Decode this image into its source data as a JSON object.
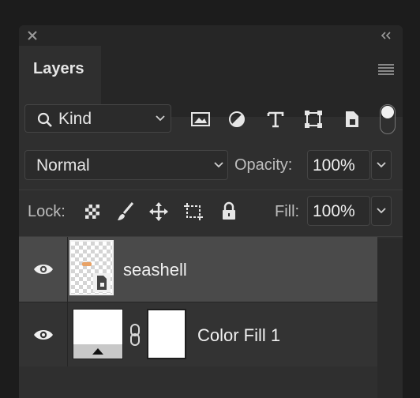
{
  "panel": {
    "tab_label": "Layers"
  },
  "filter": {
    "kind_label": "Kind",
    "filter_icons": [
      "image-filter-icon",
      "adjustment-filter-icon",
      "type-filter-icon",
      "shape-filter-icon",
      "smart-object-filter-icon"
    ],
    "toggle": "filter-toggle"
  },
  "blend": {
    "mode": "Normal",
    "opacity_label": "Opacity:",
    "opacity_value": "100%"
  },
  "lock": {
    "label": "Lock:",
    "icons": [
      "lock-transparent-pixels-icon",
      "lock-image-pixels-icon",
      "lock-position-icon",
      "lock-artboard-icon",
      "lock-all-icon"
    ],
    "fill_label": "Fill:",
    "fill_value": "100%"
  },
  "layers": [
    {
      "name": "seashell",
      "visible": true,
      "selected": true,
      "kind": "smart-object"
    },
    {
      "name": "Color Fill 1",
      "visible": true,
      "selected": false,
      "kind": "fill-with-mask"
    }
  ],
  "colors": {
    "panel_bg": "#2f2f2f",
    "selected_row": "#4a4a4a",
    "text": "#e6e6e6"
  }
}
